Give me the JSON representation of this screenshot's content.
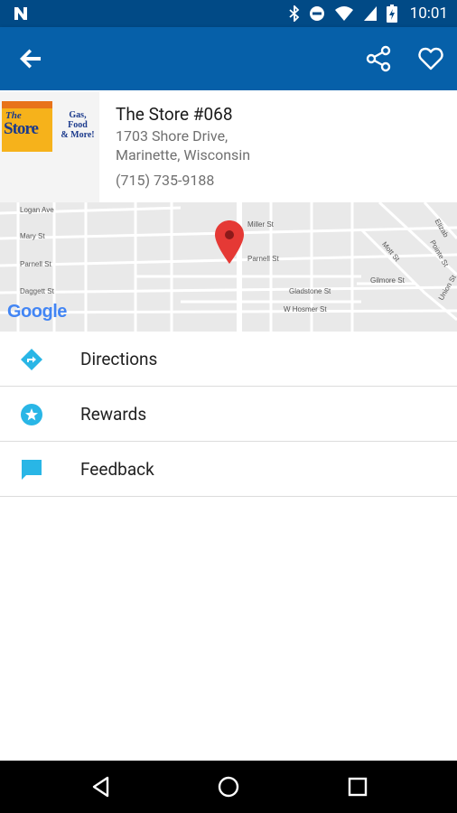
{
  "status_bar": {
    "time": "10:01"
  },
  "store": {
    "name": "The Store #068",
    "address_line1": "1703 Shore Drive,",
    "address_line2": "Marinette, Wisconsin",
    "phone": "(715) 735-9188",
    "logo": {
      "brand_top": "The",
      "brand_bottom": "Store",
      "tagline_1": "Gas,",
      "tagline_2": "Food",
      "tagline_3": "& More!"
    }
  },
  "map": {
    "attribution": "Google",
    "streets": [
      "Logan Ave",
      "Mary St",
      "Parnell St",
      "Daggett St",
      "Miller St",
      "Parnell St",
      "Gladstone St",
      "W Hosmer St",
      "Gilmore St",
      "Mott St",
      "Pointe St",
      "Elizab",
      "Union St"
    ]
  },
  "actions": [
    {
      "label": "Directions",
      "icon": "directions-icon"
    },
    {
      "label": "Rewards",
      "icon": "star-badge-icon"
    },
    {
      "label": "Feedback",
      "icon": "feedback-icon"
    }
  ],
  "colors": {
    "status_bar": "#014a86",
    "app_bar": "#0660a9",
    "accent": "#29b6e6",
    "map_pin": "#e53935"
  }
}
